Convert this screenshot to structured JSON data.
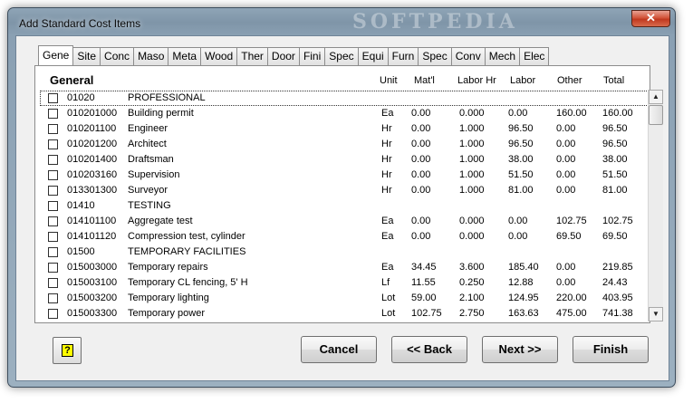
{
  "window": {
    "title": "Add Standard Cost Items",
    "watermark": "SOFTPEDIA",
    "close_glyph": "✕"
  },
  "tabs": [
    "Gene",
    "Site",
    "Conc",
    "Maso",
    "Meta",
    "Wood",
    "Ther",
    "Door",
    "Fini",
    "Spec",
    "Equi",
    "Furn",
    "Spec",
    "Conv",
    "Mech",
    "Elec"
  ],
  "columns": {
    "group": "General",
    "unit": "Unit",
    "matl": "Mat'l",
    "labor_hr": "Labor Hr",
    "labor": "Labor",
    "other": "Other",
    "total": "Total"
  },
  "rows": [
    {
      "code": "01020",
      "desc": "PROFESSIONAL",
      "unit": "",
      "matl": "",
      "labor_hr": "",
      "labor": "",
      "other": "",
      "total": ""
    },
    {
      "code": "010201000",
      "desc": "Building permit",
      "unit": "Ea",
      "matl": "0.00",
      "labor_hr": "0.000",
      "labor": "0.00",
      "other": "160.00",
      "total": "160.00"
    },
    {
      "code": "010201100",
      "desc": "Engineer",
      "unit": "Hr",
      "matl": "0.00",
      "labor_hr": "1.000",
      "labor": "96.50",
      "other": "0.00",
      "total": "96.50"
    },
    {
      "code": "010201200",
      "desc": "Architect",
      "unit": "Hr",
      "matl": "0.00",
      "labor_hr": "1.000",
      "labor": "96.50",
      "other": "0.00",
      "total": "96.50"
    },
    {
      "code": "010201400",
      "desc": "Draftsman",
      "unit": "Hr",
      "matl": "0.00",
      "labor_hr": "1.000",
      "labor": "38.00",
      "other": "0.00",
      "total": "38.00"
    },
    {
      "code": "010203160",
      "desc": "Supervision",
      "unit": "Hr",
      "matl": "0.00",
      "labor_hr": "1.000",
      "labor": "51.50",
      "other": "0.00",
      "total": "51.50"
    },
    {
      "code": "013301300",
      "desc": "Surveyor",
      "unit": "Hr",
      "matl": "0.00",
      "labor_hr": "1.000",
      "labor": "81.00",
      "other": "0.00",
      "total": "81.00"
    },
    {
      "code": "01410",
      "desc": "TESTING",
      "unit": "",
      "matl": "",
      "labor_hr": "",
      "labor": "",
      "other": "",
      "total": ""
    },
    {
      "code": "014101100",
      "desc": "Aggregate test",
      "unit": "Ea",
      "matl": "0.00",
      "labor_hr": "0.000",
      "labor": "0.00",
      "other": "102.75",
      "total": "102.75"
    },
    {
      "code": "014101120",
      "desc": "Compression test, cylinder",
      "unit": "Ea",
      "matl": "0.00",
      "labor_hr": "0.000",
      "labor": "0.00",
      "other": "69.50",
      "total": "69.50"
    },
    {
      "code": "01500",
      "desc": "TEMPORARY FACILITIES",
      "unit": "",
      "matl": "",
      "labor_hr": "",
      "labor": "",
      "other": "",
      "total": ""
    },
    {
      "code": "015003000",
      "desc": "Temporary repairs",
      "unit": "Ea",
      "matl": "34.45",
      "labor_hr": "3.600",
      "labor": "185.40",
      "other": "0.00",
      "total": "219.85"
    },
    {
      "code": "015003100",
      "desc": "Temporary CL fencing, 5' H",
      "unit": "Lf",
      "matl": "11.55",
      "labor_hr": "0.250",
      "labor": "12.88",
      "other": "0.00",
      "total": "24.43"
    },
    {
      "code": "015003200",
      "desc": "Temporary lighting",
      "unit": "Lot",
      "matl": "59.00",
      "labor_hr": "2.100",
      "labor": "124.95",
      "other": "220.00",
      "total": "403.95"
    },
    {
      "code": "015003300",
      "desc": "Temporary power",
      "unit": "Lot",
      "matl": "102.75",
      "labor_hr": "2.750",
      "labor": "163.63",
      "other": "475.00",
      "total": "741.38"
    }
  ],
  "scrollbar": {
    "up_glyph": "▲",
    "down_glyph": "▼"
  },
  "help": {
    "label": "?"
  },
  "buttons": {
    "cancel": "Cancel",
    "back": "<< Back",
    "next": "Next >>",
    "finish": "Finish"
  }
}
